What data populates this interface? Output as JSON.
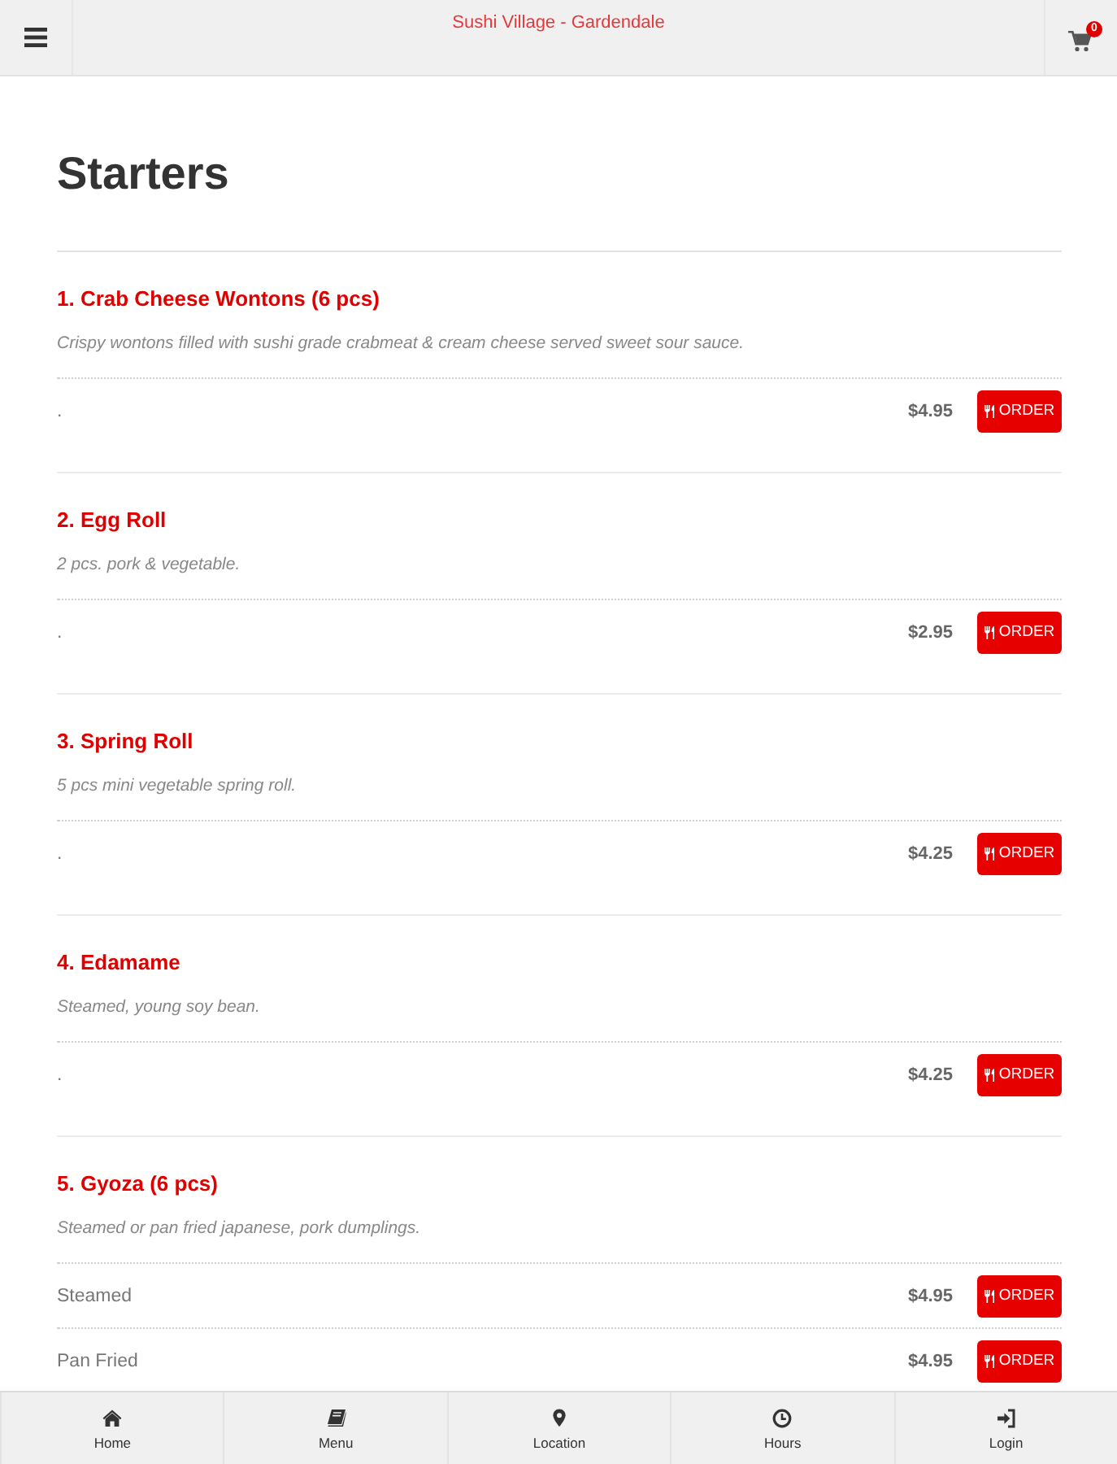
{
  "header": {
    "title": "Sushi Village - Gardendale",
    "cart_count": "0"
  },
  "section": {
    "title": "Starters",
    "items": [
      {
        "name": "1. Crab Cheese Wontons (6 pcs)",
        "description": "Crispy wontons filled with sushi grade crabmeat & cream cheese served sweet sour sauce.",
        "options": [
          {
            "label": ".",
            "price": "$4.95",
            "button": "ORDER"
          }
        ]
      },
      {
        "name": "2. Egg Roll",
        "description": "2 pcs. pork & vegetable.",
        "options": [
          {
            "label": ".",
            "price": "$2.95",
            "button": "ORDER"
          }
        ]
      },
      {
        "name": "3. Spring Roll",
        "description": "5 pcs mini vegetable spring roll.",
        "options": [
          {
            "label": ".",
            "price": "$4.25",
            "button": "ORDER"
          }
        ]
      },
      {
        "name": "4. Edamame",
        "description": "Steamed, young soy bean.",
        "options": [
          {
            "label": ".",
            "price": "$4.25",
            "button": "ORDER"
          }
        ]
      },
      {
        "name": "5. Gyoza (6 pcs)",
        "description": "Steamed or pan fried japanese, pork dumplings.",
        "options": [
          {
            "label": "Steamed",
            "price": "$4.95",
            "button": "ORDER"
          },
          {
            "label": "Pan Fried",
            "price": "$4.95",
            "button": "ORDER"
          }
        ]
      }
    ]
  },
  "bottom_nav": [
    {
      "kind": "home",
      "label": "Home"
    },
    {
      "kind": "menu",
      "label": "Menu"
    },
    {
      "kind": "location",
      "label": "Location"
    },
    {
      "kind": "hours",
      "label": "Hours"
    },
    {
      "kind": "login",
      "label": "Login"
    }
  ]
}
